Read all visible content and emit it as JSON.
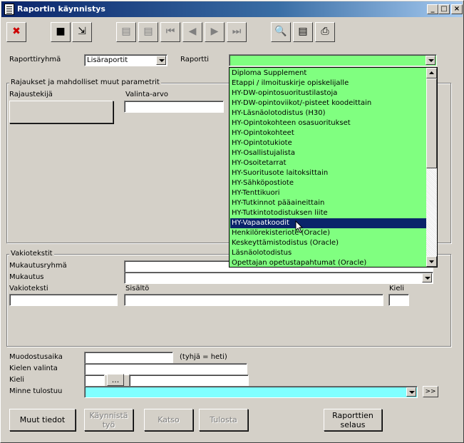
{
  "window": {
    "title": "Raportin käynnistys",
    "controls": {
      "minimize": "_",
      "maximize": "□",
      "close": "×"
    }
  },
  "toolbar": {
    "buttons": [
      {
        "icon": "close-x-icon",
        "glyph": "✖",
        "color": "#cc0000"
      },
      {
        "icon": "save-icon",
        "glyph": "■"
      },
      {
        "icon": "export-icon",
        "glyph": "⇲"
      },
      {
        "icon": "new-record-icon",
        "glyph": "▤"
      },
      {
        "icon": "delete-record-icon",
        "glyph": "▤"
      },
      {
        "icon": "first-record-icon",
        "glyph": "⏮"
      },
      {
        "icon": "previous-record-icon",
        "glyph": "◀"
      },
      {
        "icon": "next-record-icon",
        "glyph": "▶"
      },
      {
        "icon": "last-record-icon",
        "glyph": "⏭"
      },
      {
        "icon": "search-icon",
        "glyph": "🔍"
      },
      {
        "icon": "document-icon",
        "glyph": "▤"
      },
      {
        "icon": "printer-icon",
        "glyph": "⎙"
      }
    ]
  },
  "form": {
    "raporttiryhma_label": "Raporttiryhmä",
    "raporttiryhma_value": "Lisäraportit",
    "raportti_label": "Raportti",
    "raportti_value": "",
    "rajaukset_title": "Rajaukset ja mahdolliset muut parametrit",
    "rajaustekija_label": "Rajaustekijä",
    "valinta_arvo_label": "Valinta-arvo",
    "vakiotekstit_title": "Vakiotekstit",
    "mukautusryhma_label": "Mukautusryhmä",
    "mukautus_label": "Mukautus",
    "vakioteksti_label": "Vakioteksti",
    "sisalto_label": "Sisältö",
    "kieli_label": "Kieli",
    "muodostusaika_label": "Muodostusaika",
    "muodostusaika_hint": "(tyhjä = heti)",
    "kielen_valinta_label": "Kielen valinta",
    "kieli2_label": "Kieli",
    "kieli_browse_label": "...",
    "minne_label": "Minne tulostuu",
    "minne_more_label": ">>"
  },
  "dropdown": {
    "items": [
      "Diploma Supplement",
      "Etappi / ilmoituskirje opiskelijalle",
      "HY-DW-opintosuoritustilastoja",
      "HY-DW-opintoviikot/-pisteet koodeittain",
      "HY-Läsnäolotodistus (H30)",
      "HY-Opintokohteen osasuoritukset",
      "HY-Opintokohteet",
      "HY-Opintotukiote",
      "HY-Osallistujalista",
      "HY-Osoitetarrat",
      "HY-Suoritusote laitoksittain",
      "HY-Sähköpostiote",
      "HY-Tenttikuori",
      "HY-Tutkinnot pääaineittain",
      "HY-Tutkintotodistuksen liite",
      "HY-Vapaatkoodit",
      "Henkilörekisteriote (Oracle)",
      "Keskeyttämistodistus (Oracle)",
      "Läsnäolotodistus",
      "Opettajan opetustapahtumat  (Oracle)"
    ],
    "selected_index": 15
  },
  "buttons": {
    "muut_tiedot": "Muut tiedot",
    "kaynnista_1": "Käynnistä",
    "kaynnista_2": "työ",
    "katso": "Katso",
    "tulosta": "Tulosta",
    "raporttien_1": "Raporttien",
    "raporttien_2": "selaus"
  },
  "colors": {
    "highlight_green": "#80ff80",
    "highlight_cyan": "#80ffff",
    "selection": "#0a246a"
  }
}
